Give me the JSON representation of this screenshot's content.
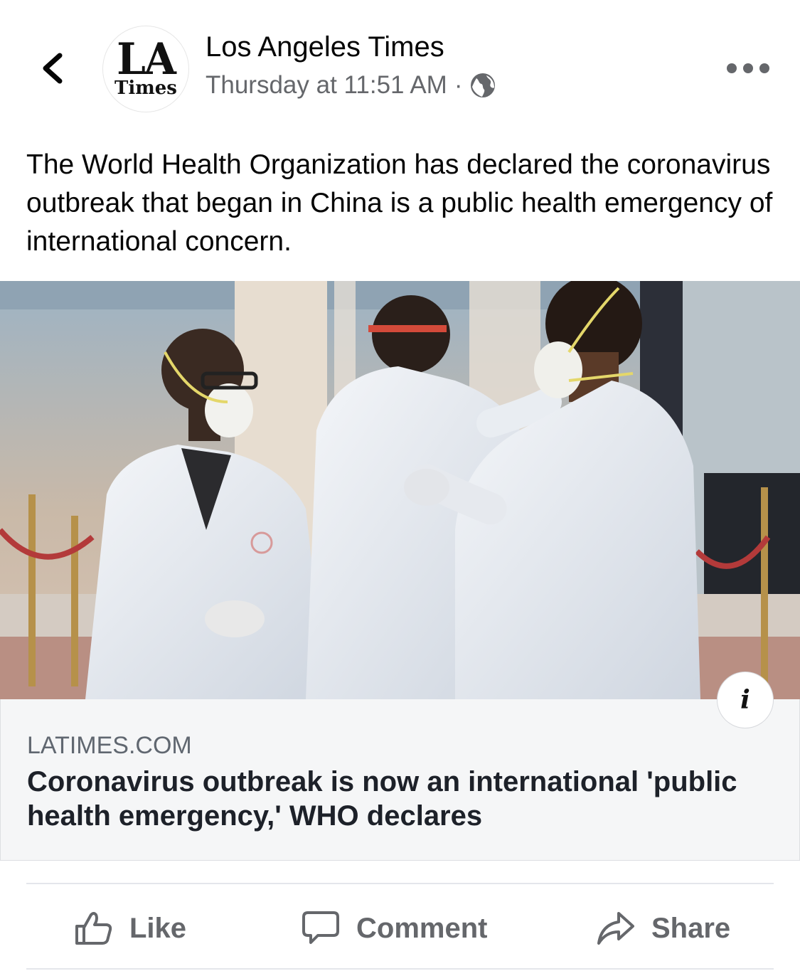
{
  "post": {
    "page_name": "Los Angeles Times",
    "timestamp": "Thursday at 11:51 AM",
    "separator": "·",
    "privacy_icon": "globe-icon",
    "avatar": {
      "line1": "LA",
      "line2": "Times"
    },
    "text": "The World Health Organization has declared the coronavirus outbreak that began in China is a public health emergency of international concern."
  },
  "link_preview": {
    "domain": "LATIMES.COM",
    "headline": "Coronavirus outbreak is now an international 'public health emergency,' WHO declares",
    "info_label": "i"
  },
  "actions": {
    "like_label": "Like",
    "comment_label": "Comment",
    "share_label": "Share"
  },
  "colors": {
    "secondary_text": "#65676b",
    "card_background": "#f5f6f7"
  }
}
